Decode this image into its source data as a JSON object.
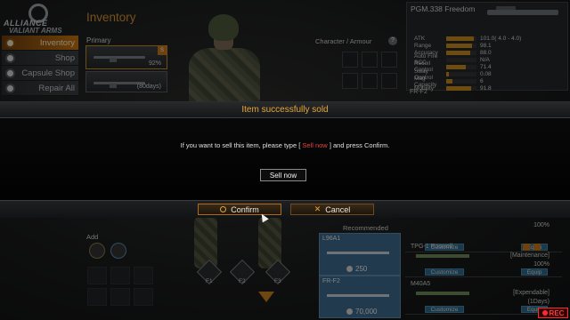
{
  "logo": {
    "line1": "ALLIANCE",
    "line2": "VALIANT ARMS"
  },
  "sidebar": {
    "items": [
      {
        "label": "Inventory",
        "icon": "inventory-icon",
        "active": true
      },
      {
        "label": "Shop",
        "icon": "shop-icon",
        "active": false
      },
      {
        "label": "Capsule Shop",
        "icon": "capsule-icon",
        "active": false
      },
      {
        "label": "Repair All",
        "icon": "repair-icon",
        "active": false
      }
    ]
  },
  "inventory": {
    "title": "Inventory",
    "primary_label": "Primary",
    "slots": [
      {
        "value": "92%"
      },
      {
        "value": "(80days)"
      }
    ],
    "character_armour_label": "Character / Armour",
    "add_label": "Add",
    "f_keys": [
      "F1",
      "F2",
      "F3"
    ]
  },
  "weapon_detail": {
    "name": "PGM.338 Freedom",
    "stats": [
      {
        "name": "ATK",
        "value": "101.0( 4.0 - 4.0)",
        "fill": 0.9
      },
      {
        "name": "Range",
        "value": "98.1",
        "fill": 0.85
      },
      {
        "name": "Accuracy",
        "value": "88.0",
        "fill": 0.78
      },
      {
        "name": "Auto Fire SCC",
        "value": "N/A",
        "fill": 0.0
      },
      {
        "name": "Recoil Control",
        "value": "71.4",
        "fill": 0.64
      },
      {
        "name": "Sway Control",
        "value": "0.08",
        "fill": 0.1
      },
      {
        "name": "Mag Capacity",
        "value": "6",
        "fill": 0.2
      },
      {
        "name": "Mobility",
        "value": "91.8",
        "fill": 0.82
      }
    ],
    "next_item": "FR-F2"
  },
  "recommended": {
    "label": "Recommended",
    "items": [
      {
        "name": "L96A1",
        "price": "250"
      },
      {
        "name": "FR-F2",
        "price": "70,000"
      }
    ]
  },
  "item_list": [
    {
      "name": "",
      "status": "100%",
      "customize": "Customize",
      "equip": "Equip"
    },
    {
      "name": "TPG-1 Roswell",
      "status": "[Maintenance]",
      "percent": "100%",
      "customize": "Customize",
      "equip": "Equip"
    },
    {
      "name": "M40A5",
      "status": "[Expendable]",
      "percent": "(1Days)",
      "customize": "Customize",
      "equip": "Equip"
    }
  ],
  "modal": {
    "title": "Item successfully sold",
    "message_before": "If you want to sell this item, please type [ ",
    "message_keyword": "Sell now",
    "message_after": " ] and press Confirm.",
    "input_value": "Sell now",
    "confirm_label": "Confirm",
    "cancel_label": "Cancel"
  },
  "recording": {
    "label": "REC"
  },
  "colors": {
    "accent": "#e6a73a",
    "highlight": "#e2463b",
    "active_tab": "#c8750f",
    "recommend_card": "#3c6a8c"
  }
}
